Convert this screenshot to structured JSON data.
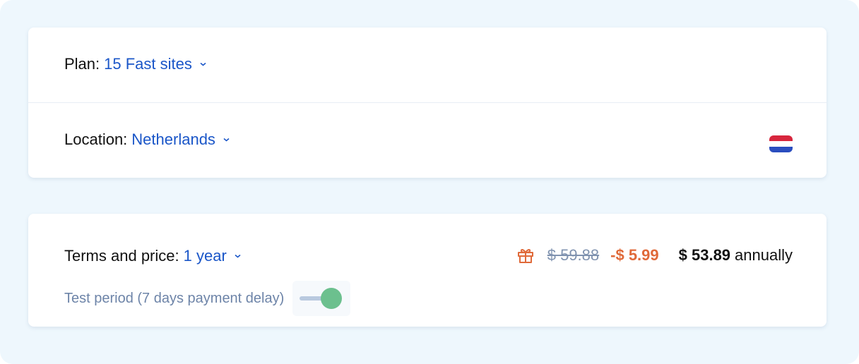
{
  "plan": {
    "label": "Plan:",
    "value": "15 Fast sites"
  },
  "location": {
    "label": "Location:",
    "value": "Netherlands",
    "flag_icon": "netherlands-flag-icon",
    "flag_colors": [
      "#d7263d",
      "#ffffff",
      "#2a4dbf"
    ]
  },
  "terms": {
    "label": "Terms and price:",
    "value": "1 year",
    "test_period_label": "Test period (7 days payment delay)",
    "test_period_enabled": true,
    "gift_icon": "gift-icon",
    "old_price": "$ 59.88",
    "discount": "-$ 5.99",
    "final_price": "$ 53.89",
    "period": "annually"
  },
  "colors": {
    "accent": "#1a56c8",
    "discount": "#e06a3a",
    "toggle_on": "#6cc08e"
  }
}
